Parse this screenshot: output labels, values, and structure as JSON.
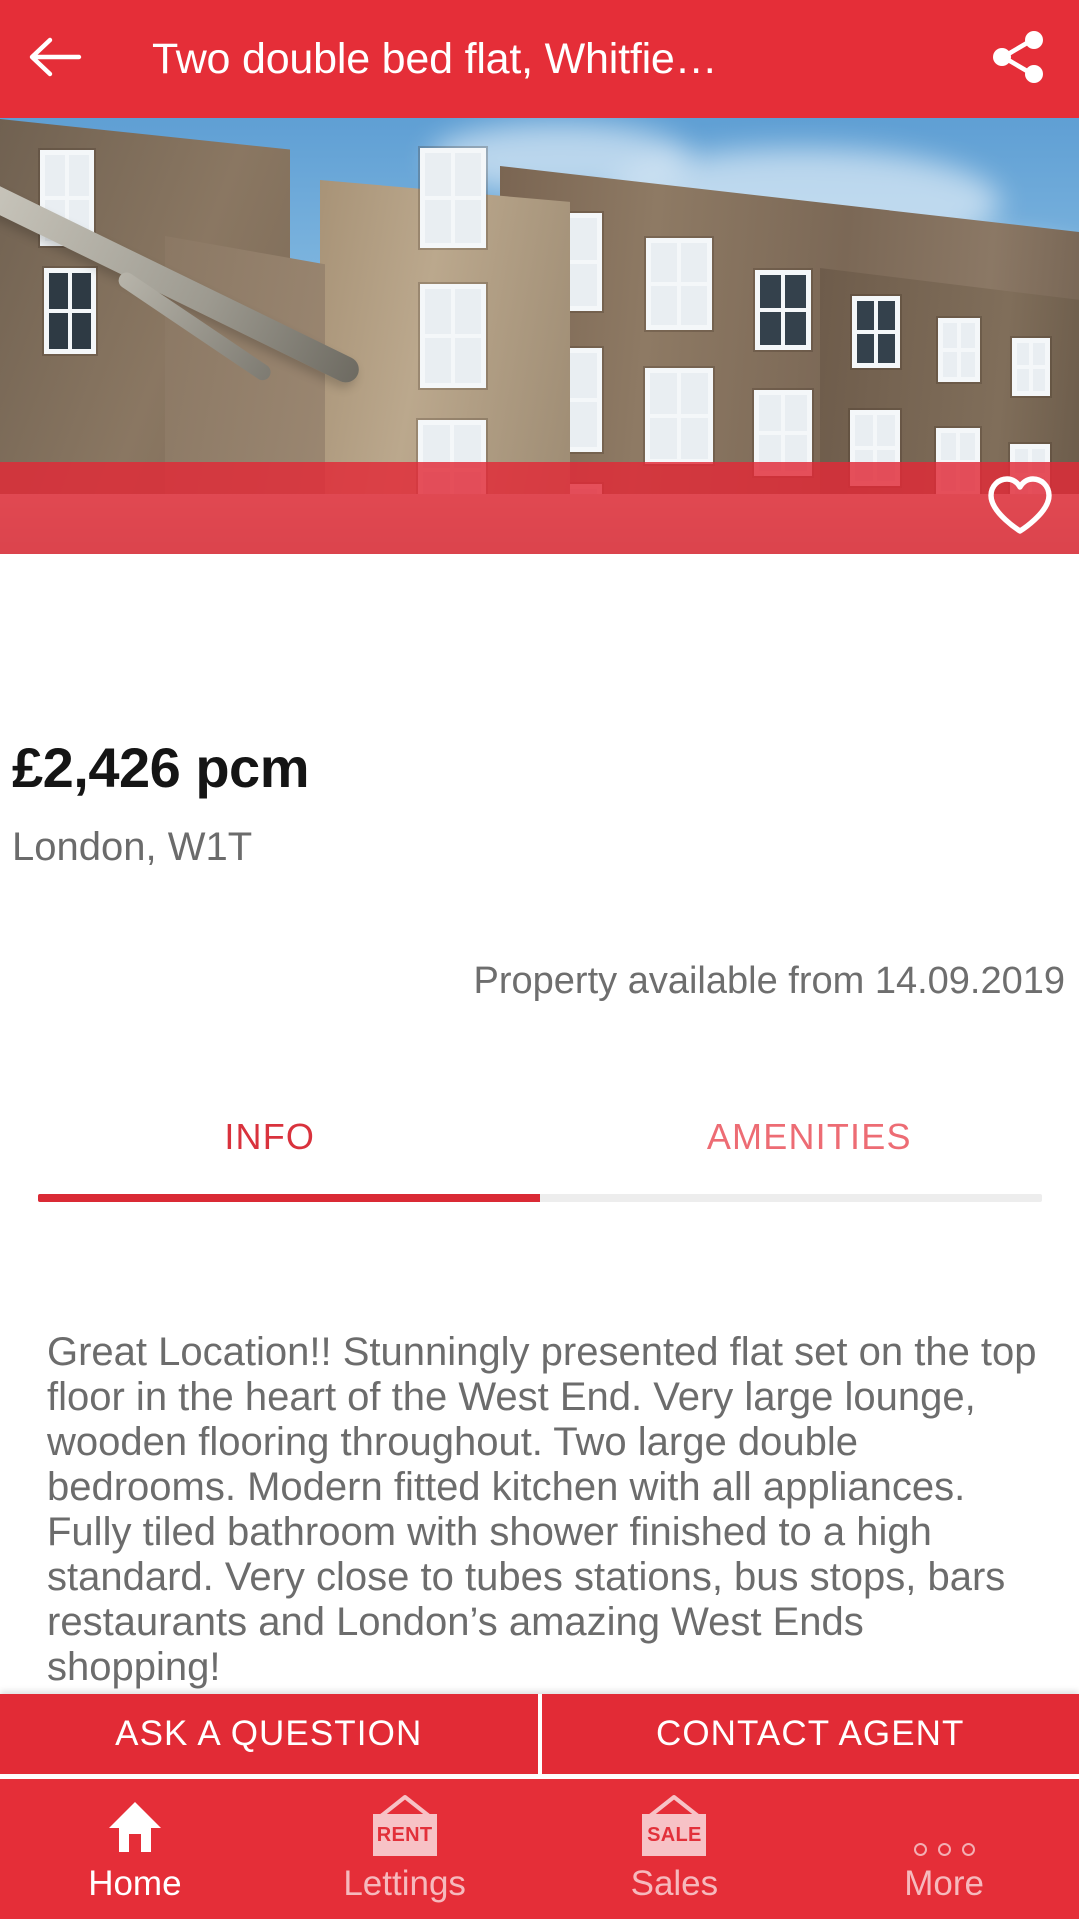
{
  "appbar": {
    "back_icon": "back-arrow-icon",
    "title": "Two double bed flat, Whitfie…",
    "share_icon": "share-icon"
  },
  "hero": {
    "photo_alt": "Brick Georgian terrace building exterior with white sash windows",
    "favourite_icon": "heart-outline-icon"
  },
  "listing": {
    "price": "£2,426 pcm",
    "locality": "London, W1T",
    "availability": "Property available from 14.09.2019"
  },
  "tabs": [
    {
      "label": "INFO",
      "active": true
    },
    {
      "label": "AMENITIES",
      "active": false
    }
  ],
  "description": "Great Location!! Stunningly presented flat set on the top floor in the heart of the West End. Very large lounge, wooden flooring throughout. Two large double bedrooms. Modern fitted kitchen with all appliances. Fully tiled bathroom with shower finished to a high standard. Very close to tubes stations, bus stops, bars restaurants and London’s amazing West Ends shopping!",
  "actions": {
    "ask_label": "ASK A QUESTION",
    "contact_label": "CONTACT AGENT"
  },
  "bottom_nav": [
    {
      "label": "Home",
      "icon": "home-icon",
      "badge": "",
      "active": true
    },
    {
      "label": "Lettings",
      "icon": "rent-sign-icon",
      "badge": "RENT",
      "active": false
    },
    {
      "label": "Sales",
      "icon": "sale-sign-icon",
      "badge": "SALE",
      "active": false
    },
    {
      "label": "More",
      "icon": "more-dots-icon",
      "badge": "",
      "active": false
    }
  ],
  "colors": {
    "brand_red": "#E52E38",
    "action_red": "#E22B36",
    "tab_active": "#D9323D",
    "tab_inactive": "#ED6C74",
    "nav_inactive": "#F6B9BD",
    "text_muted": "#6C6C6C",
    "price_text": "#151515"
  }
}
